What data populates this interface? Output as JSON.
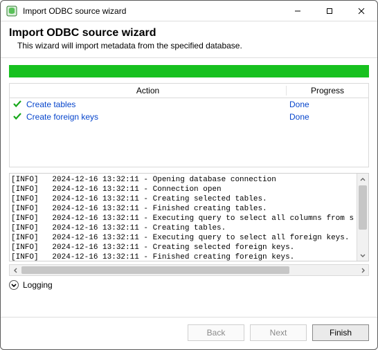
{
  "window": {
    "title": "Import ODBC source wizard"
  },
  "header": {
    "title": "Import ODBC source wizard",
    "subtitle": "This wizard will import metadata from the specified database."
  },
  "columns": {
    "action": "Action",
    "progress": "Progress"
  },
  "tasks": [
    {
      "label": "Create tables",
      "status": "Done"
    },
    {
      "label": "Create foreign keys",
      "status": "Done"
    }
  ],
  "log_lines": [
    "[INFO]   2024-12-16 13:32:11 - Opening database connection",
    "[INFO]   2024-12-16 13:32:11 - Connection open",
    "[INFO]   2024-12-16 13:32:11 - Creating selected tables.",
    "[INFO]   2024-12-16 13:32:11 - Finished creating tables.",
    "[INFO]   2024-12-16 13:32:11 - Executing query to select all columns from s",
    "[INFO]   2024-12-16 13:32:11 - Creating tables.",
    "[INFO]   2024-12-16 13:32:11 - Executing query to select all foreign keys. ",
    "[INFO]   2024-12-16 13:32:11 - Creating selected foreign keys.",
    "[INFO]   2024-12-16 13:32:11 - Finished creating foreign keys."
  ],
  "log_toggle_label": "Logging",
  "buttons": {
    "back": "Back",
    "next": "Next",
    "finish": "Finish"
  }
}
